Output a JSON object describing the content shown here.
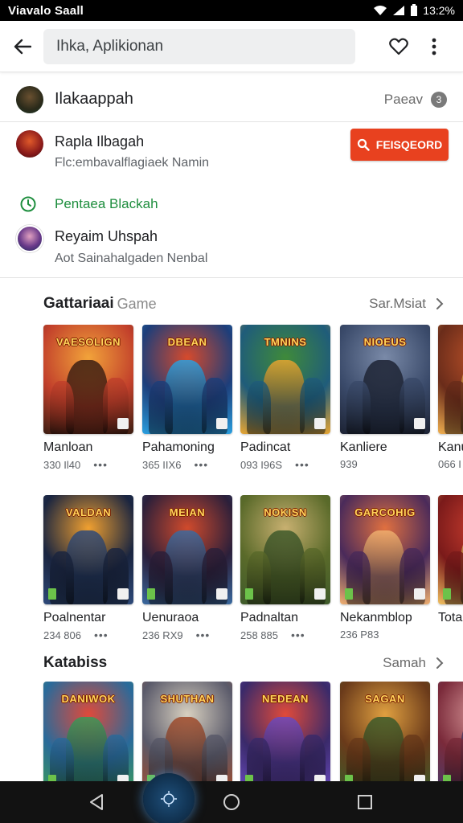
{
  "status_bar": {
    "left_text": "Viavalo Saall",
    "time": "13:2%"
  },
  "search": {
    "query": "Ihka, Aplikionan"
  },
  "suggestions": {
    "row1": {
      "title": "Ilakaappah",
      "right_label": "Paeav",
      "count": "3"
    },
    "row2": {
      "title": "Rapla Ilbagah",
      "subtitle": "Flc:embavalflagiaek Namin",
      "button_label": "FEISQEORD"
    },
    "row3": {
      "title": "Pentaea Blackah"
    },
    "row4": {
      "title": "Reyaim Uhspah",
      "subtitle": "Aot Sainahalgaden Nenbal"
    }
  },
  "sections": [
    {
      "title": "Gattariaai",
      "title_suffix": "Game",
      "more_label": "Sar.Msiat",
      "games": [
        {
          "name": "Manloan",
          "meta": "330 Il40",
          "logo": "VAESOLIGN",
          "palette": [
            "#c2402b",
            "#f2a33a",
            "#3a1d12"
          ]
        },
        {
          "name": "Pahamoning",
          "meta": "365 IIX6",
          "logo": "DBEAN",
          "palette": [
            "#1d3e7a",
            "#d64a2c",
            "#2aa0e0"
          ]
        },
        {
          "name": "Padincat",
          "meta": "093 I96S",
          "logo": "TMNINS",
          "palette": [
            "#1f5c7a",
            "#3f8a3a",
            "#e8a531"
          ]
        },
        {
          "name": "Kanliere",
          "meta": "939",
          "logo": "NIOEUS",
          "palette": [
            "#3a4a6a",
            "#7a8aa8",
            "#1c2233"
          ]
        },
        {
          "name": "Kanu",
          "meta": "066 I",
          "logo": "S",
          "palette": [
            "#6a2c1a",
            "#c4552a",
            "#f0b050"
          ]
        }
      ]
    },
    {
      "title": "",
      "title_suffix": "",
      "more_label": "",
      "games": [
        {
          "name": "Poalnentar",
          "meta": "234 806",
          "logo": "VALDAN",
          "palette": [
            "#1a2540",
            "#f0a030",
            "#2e4a7a"
          ]
        },
        {
          "name": "Uenuraoa",
          "meta": "236 RX9",
          "logo": "MEIAN",
          "palette": [
            "#2b1f3a",
            "#d04a2c",
            "#3a6aa0"
          ]
        },
        {
          "name": "Padnaltan",
          "meta": "258 885",
          "logo": "NOKISN",
          "palette": [
            "#5a6a2a",
            "#c8b070",
            "#3e5a2a"
          ]
        },
        {
          "name": "Nekanmblop",
          "meta": "236 P83",
          "logo": "GARCOHIG",
          "palette": [
            "#4a2a5a",
            "#e07040",
            "#f0b070"
          ]
        },
        {
          "name": "Tota",
          "meta": "",
          "logo": "T",
          "palette": [
            "#7a1a1a",
            "#d04030",
            "#f0c060"
          ]
        }
      ]
    },
    {
      "title": "Katabiss",
      "title_suffix": "",
      "more_label": "Samah",
      "games": [
        {
          "name": "",
          "meta": "",
          "logo": "DANIWOK",
          "palette": [
            "#2a6a9a",
            "#e04a3a",
            "#3a9a5a"
          ]
        },
        {
          "name": "",
          "meta": "",
          "logo": "SHUTHAN",
          "palette": [
            "#5a5a6a",
            "#d8d0c0",
            "#a04a2a"
          ]
        },
        {
          "name": "",
          "meta": "",
          "logo": "NEDEAN",
          "palette": [
            "#3a2a6a",
            "#e04a3a",
            "#6a4ac0"
          ]
        },
        {
          "name": "",
          "meta": "",
          "logo": "SAGAN",
          "palette": [
            "#6a3a1a",
            "#e0a040",
            "#3a5a2a"
          ]
        },
        {
          "name": "",
          "meta": "",
          "logo": "",
          "palette": [
            "#7a2a3a",
            "#e0a0a0",
            "#4a3a6a"
          ]
        }
      ]
    }
  ],
  "colors": {
    "accent_red": "#e8411f",
    "accent_green": "#1e8e3e"
  }
}
